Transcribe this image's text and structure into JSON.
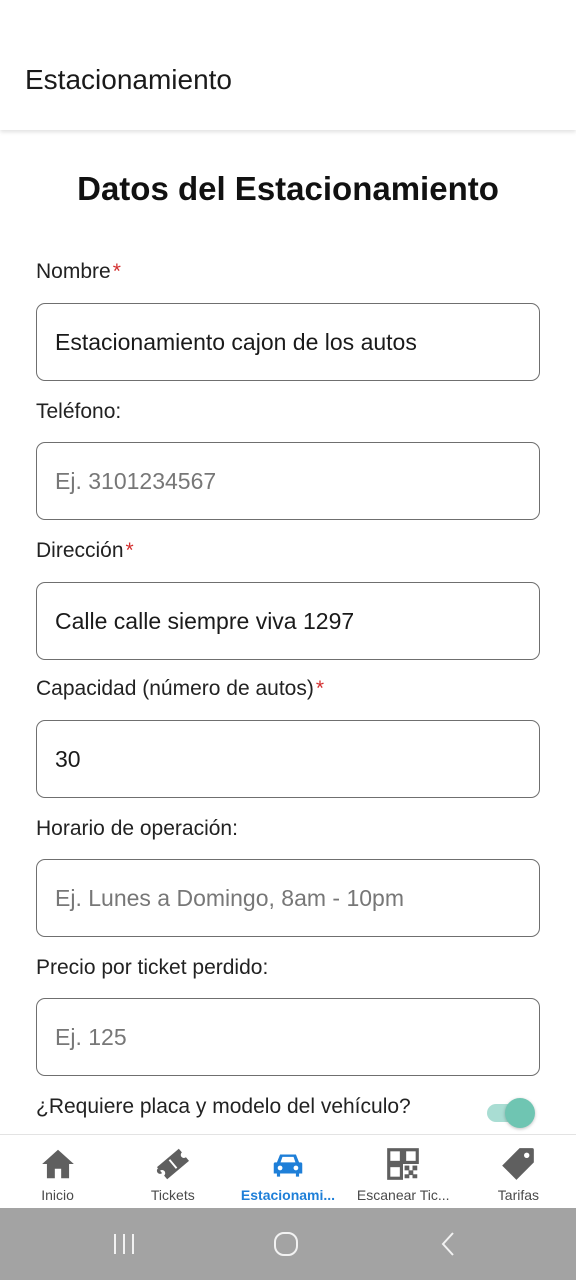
{
  "appbar": {
    "title": "Estacionamiento"
  },
  "form": {
    "title": "Datos del Estacionamiento",
    "required_mark": "*",
    "fields": [
      {
        "label": "Nombre",
        "value": "Estacionamiento cajon de los autos",
        "placeholder": ""
      },
      {
        "label": "Teléfono:",
        "value": "",
        "placeholder": "Ej. 3101234567"
      },
      {
        "label": "Dirección",
        "value": "Calle calle siempre viva 1297",
        "placeholder": ""
      },
      {
        "label": "Capacidad (número de autos)",
        "value": "30",
        "placeholder": ""
      },
      {
        "label": "Horario de operación:",
        "value": "",
        "placeholder": "Ej. Lunes a Domingo, 8am - 10pm"
      },
      {
        "label": "Precio por ticket perdido:",
        "value": "",
        "placeholder": "Ej. 125"
      }
    ],
    "toggle": {
      "label": "¿Requiere placa y modelo del vehículo?",
      "on": true
    }
  },
  "bottom_nav": {
    "items": [
      {
        "label": "Inicio",
        "icon": "home-icon",
        "active": false
      },
      {
        "label": "Tickets",
        "icon": "ticket-icon",
        "active": false
      },
      {
        "label": "Estacionami...",
        "icon": "car-icon",
        "active": true
      },
      {
        "label": "Escanear Tic...",
        "icon": "qr-code-icon",
        "active": false
      },
      {
        "label": "Tarifas",
        "icon": "tag-icon",
        "active": false
      }
    ]
  },
  "colors": {
    "accent": "#1e7fd8",
    "required": "#d32f2f",
    "toggle_thumb": "#6fc5b2",
    "toggle_track": "#a9ddd3",
    "nav_icon": "#5f5f5f",
    "system_bar": "#a3a3a3"
  },
  "system_nav": {
    "icons": [
      "recent-apps-icon",
      "home-circle-icon",
      "back-icon"
    ]
  }
}
